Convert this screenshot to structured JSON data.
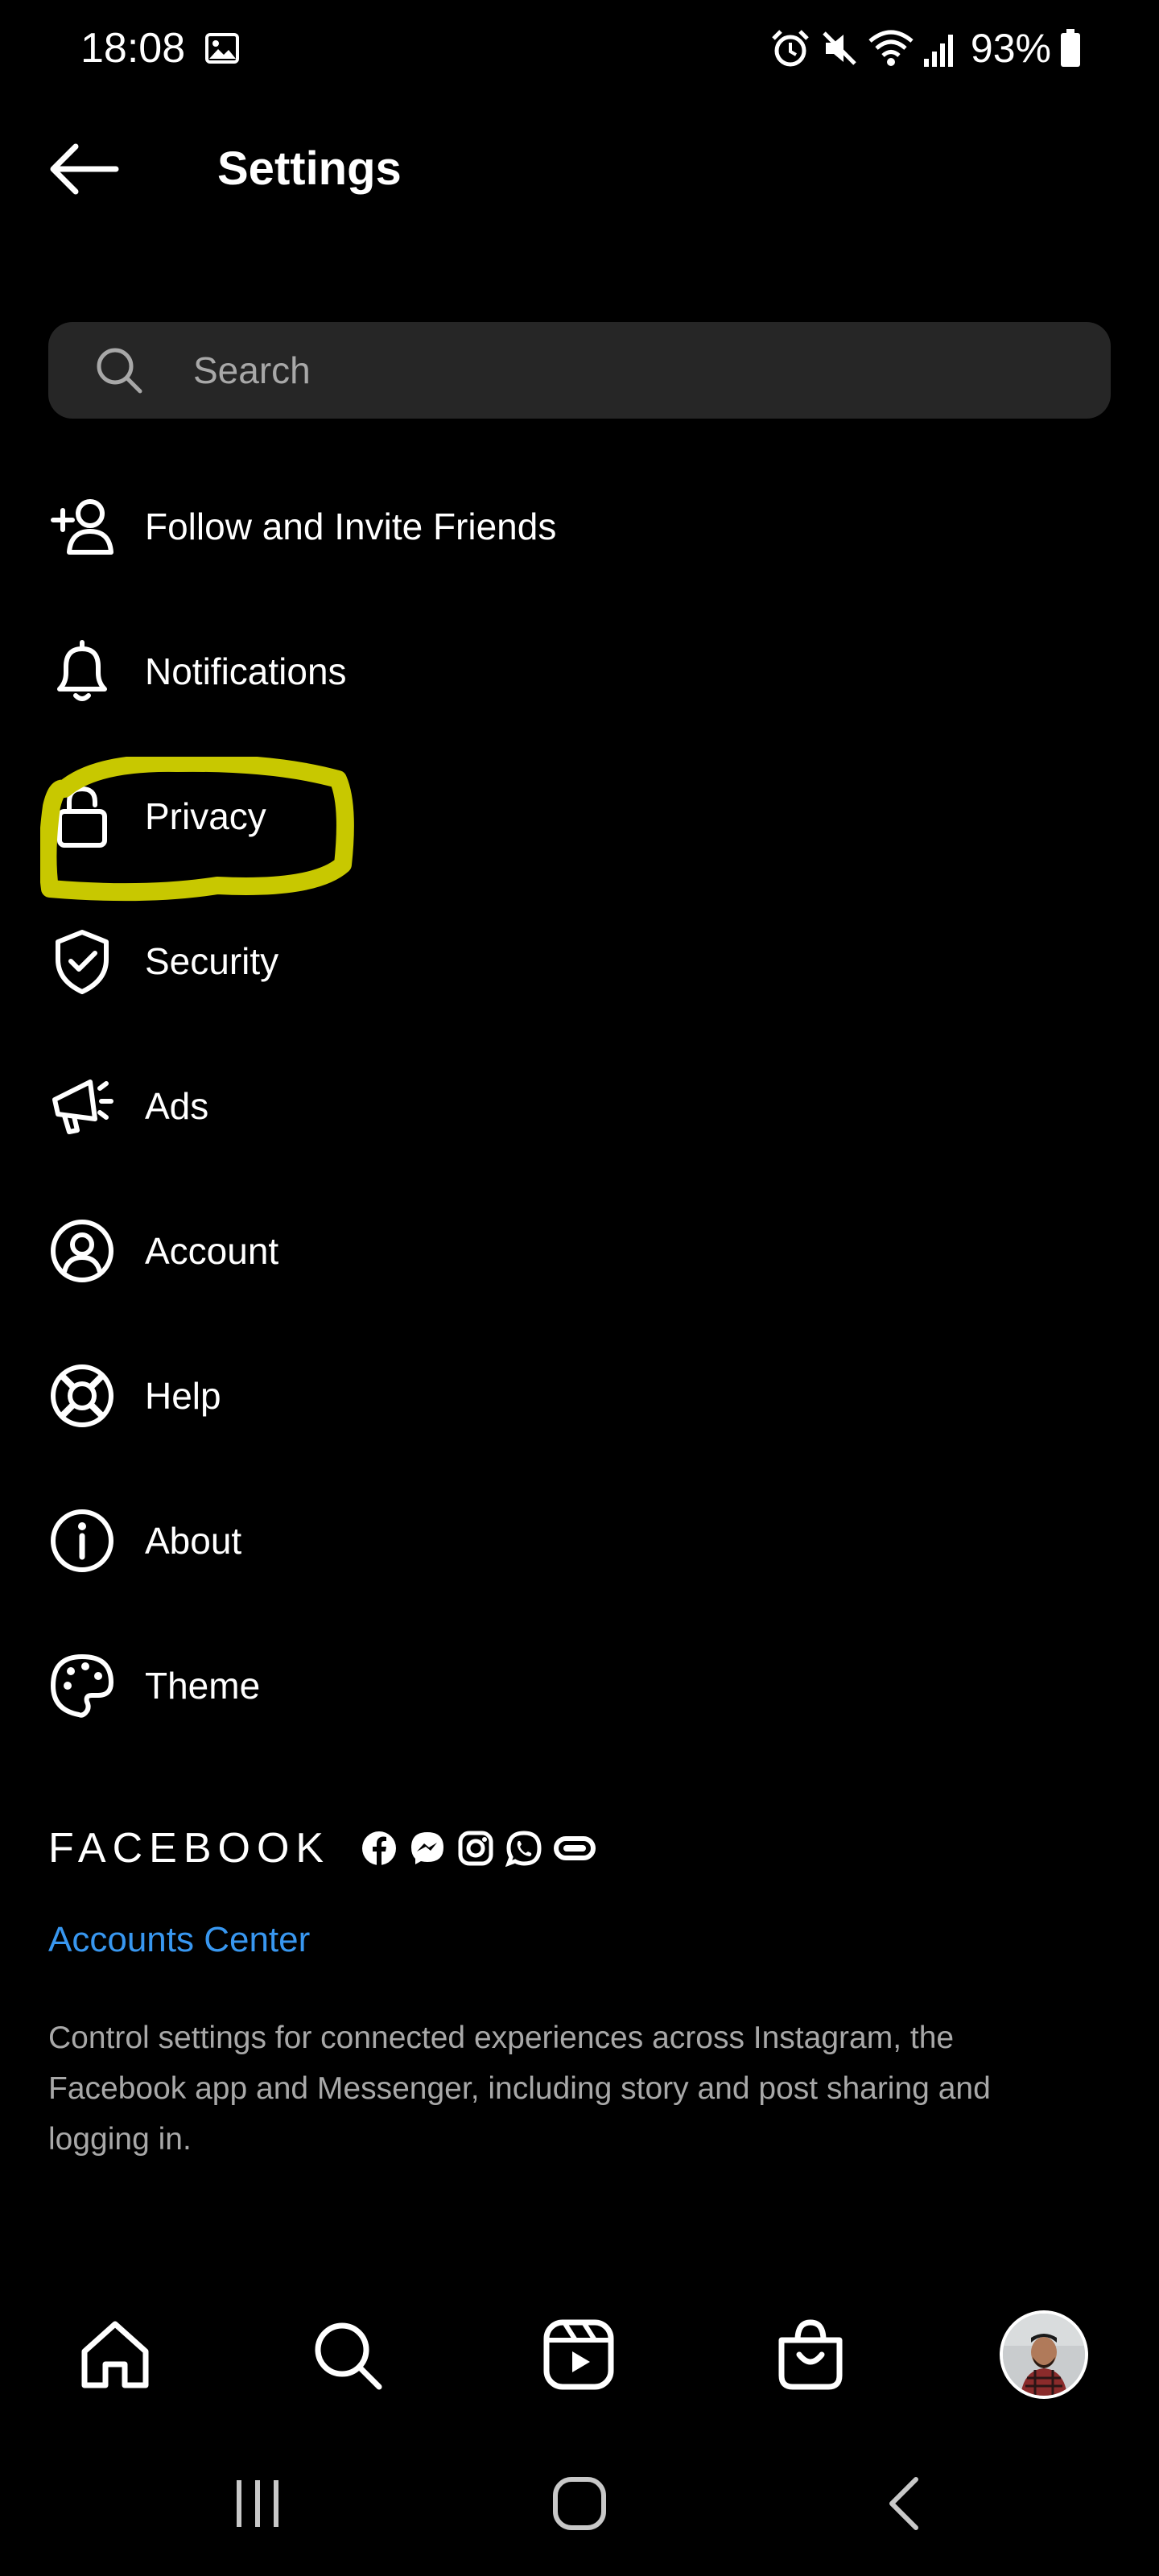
{
  "status_bar": {
    "time": "18:08",
    "battery_percent": "93%",
    "icons": [
      "gallery-icon",
      "alarm-icon",
      "mute-icon",
      "wifi-icon",
      "signal-icon",
      "battery-icon"
    ]
  },
  "header": {
    "title": "Settings",
    "back_icon": "arrow-left-icon"
  },
  "search": {
    "placeholder": "Search",
    "value": ""
  },
  "menu": {
    "items": [
      {
        "label": "Follow and Invite Friends",
        "icon": "add-person-icon"
      },
      {
        "label": "Notifications",
        "icon": "bell-icon"
      },
      {
        "label": "Privacy",
        "icon": "lock-icon"
      },
      {
        "label": "Security",
        "icon": "shield-check-icon"
      },
      {
        "label": "Ads",
        "icon": "megaphone-icon"
      },
      {
        "label": "Account",
        "icon": "user-circle-icon"
      },
      {
        "label": "Help",
        "icon": "lifebuoy-icon"
      },
      {
        "label": "About",
        "icon": "info-icon"
      },
      {
        "label": "Theme",
        "icon": "palette-icon"
      }
    ],
    "highlighted_item": "Privacy",
    "highlight_color": "#c8c800"
  },
  "footer": {
    "brand": "FACEBOOK",
    "brand_icons": [
      "facebook-icon",
      "messenger-icon",
      "instagram-icon",
      "whatsapp-icon",
      "portal-icon"
    ],
    "accounts_center_label": "Accounts Center",
    "description": "Control settings for connected experiences across Instagram, the Facebook app and Messenger, including story and post sharing and logging in."
  },
  "bottom_nav": {
    "items": [
      "home-icon",
      "search-icon",
      "reels-icon",
      "shop-icon",
      "profile-avatar"
    ]
  },
  "system_nav": {
    "items": [
      "recent-apps-icon",
      "home-button-icon",
      "back-chevron-icon"
    ]
  },
  "colors": {
    "background": "#000000",
    "search_bg": "#262626",
    "link": "#3897f0",
    "secondary_text": "#a8a8a8",
    "highlight": "#c8c800"
  }
}
